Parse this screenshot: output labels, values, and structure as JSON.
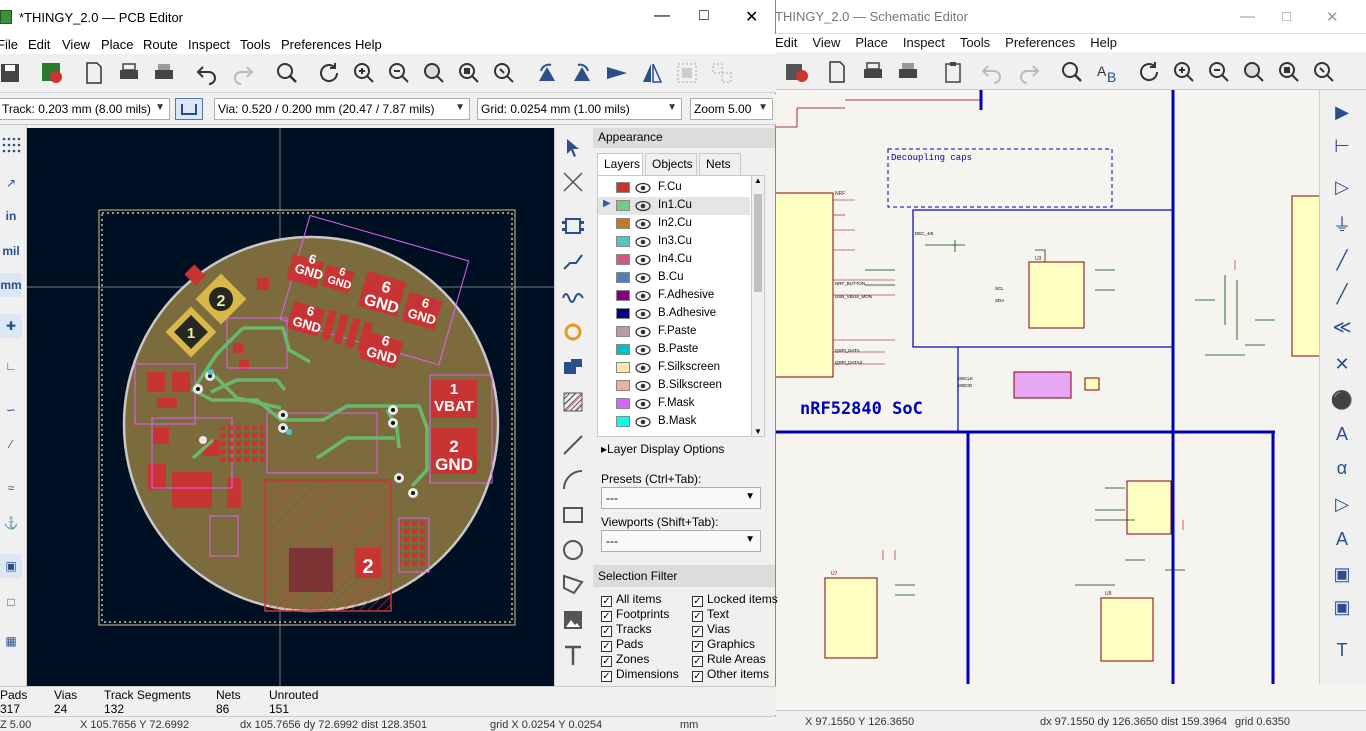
{
  "schematic": {
    "title": "THINGY_2.0 — Schematic Editor",
    "menu": [
      "Edit",
      "View",
      "Place",
      "Inspect",
      "Tools",
      "Preferences",
      "Help"
    ],
    "soc_label": "nRF52840 SoC",
    "status": {
      "coords": "X 97.1550  Y 126.3650",
      "delta": "dx 97.1550  dy 126.3650  dist 159.3964",
      "grid": "grid 0.6350"
    }
  },
  "pcb": {
    "title": "*THINGY_2.0 — PCB Editor",
    "menu": [
      "File",
      "Edit",
      "View",
      "Place",
      "Route",
      "Inspect",
      "Tools",
      "Preferences",
      "Help"
    ],
    "track_combo": "Track: 0.203 mm (8.00 mils)",
    "via_combo": "Via: 0.520 / 0.200 mm (20.47 / 7.87 mils)",
    "grid_combo": "Grid: 0.0254 mm (1.00 mils)",
    "zoom_combo": "Zoom 5.00",
    "units": [
      "in",
      "mil",
      "mm"
    ],
    "board_labels": {
      "gnd": "GND",
      "vbat": "VBAT",
      "pad1": "1",
      "pad2": "2",
      "pad6": "6"
    },
    "appearance": {
      "header": "Appearance",
      "tabs": [
        "Layers",
        "Objects",
        "Nets"
      ],
      "layers": [
        {
          "name": "F.Cu",
          "color": "#c83434"
        },
        {
          "name": "In1.Cu",
          "color": "#7fc87f"
        },
        {
          "name": "In2.Cu",
          "color": "#c2792a"
        },
        {
          "name": "In3.Cu",
          "color": "#4dc7c7"
        },
        {
          "name": "In4.Cu",
          "color": "#d2597a"
        },
        {
          "name": "B.Cu",
          "color": "#4d7fc4"
        },
        {
          "name": "F.Adhesive",
          "color": "#840084"
        },
        {
          "name": "B.Adhesive",
          "color": "#000084"
        },
        {
          "name": "F.Paste",
          "color": "#b4a09a"
        },
        {
          "name": "B.Paste",
          "color": "#00c2c2"
        },
        {
          "name": "F.Silkscreen",
          "color": "#f2eda1"
        },
        {
          "name": "B.Silkscreen",
          "color": "#e8b2a7"
        },
        {
          "name": "F.Mask",
          "color": "#d864ff"
        },
        {
          "name": "B.Mask",
          "color": "#02ffee"
        }
      ],
      "selected_layer": "In1.Cu",
      "layer_display_options": "Layer Display Options",
      "presets_label": "Presets (Ctrl+Tab):",
      "presets_value": "---",
      "viewports_label": "Viewports (Shift+Tab):",
      "viewports_value": "---",
      "selection_filter": "Selection Filter",
      "filters_left": [
        "All items",
        "Footprints",
        "Tracks",
        "Pads",
        "Zones",
        "Dimensions"
      ],
      "filters_right": [
        "Locked items",
        "Text",
        "Vias",
        "Graphics",
        "Rule Areas",
        "Other items"
      ]
    },
    "message_panel": {
      "headers": [
        "Pads",
        "Vias",
        "Track Segments",
        "Nets",
        "Unrouted"
      ],
      "values": [
        "317",
        "24",
        "132",
        "86",
        "151"
      ]
    },
    "status": {
      "zoom": "Z 5.00",
      "coords": "X 105.7656  Y 72.6992",
      "delta": "dx 105.7656  dy 72.6992  dist 128.3501",
      "grid": "grid X 0.0254  Y 0.0254",
      "units": "mm"
    }
  }
}
